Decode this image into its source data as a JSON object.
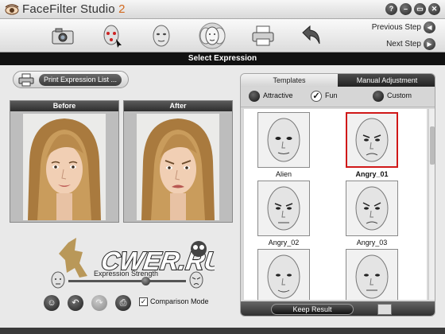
{
  "app": {
    "title_main": "FaceFilter Studio",
    "title_version": "2",
    "window_buttons": [
      "?",
      "–",
      "▭",
      "✕"
    ]
  },
  "toolbar": {
    "tools": [
      "camera-icon",
      "face-points-icon",
      "face-edit-icon",
      "expressions-icon",
      "printer-icon",
      "share-icon"
    ],
    "previous_step": "Previous Step",
    "next_step": "Next Step"
  },
  "section_title": "Select Expression",
  "left": {
    "print_button": "Print Expression List ...",
    "before_label": "Before",
    "after_label": "After",
    "expression_strength_label": "Expression Strength",
    "comparison_mode_label": "Comparison Mode",
    "comparison_mode_checked": true,
    "watermark_text": "CWER.RU"
  },
  "right": {
    "tabs": [
      "Templates",
      "Manual Adjustment"
    ],
    "active_tab": "Templates",
    "filters": [
      {
        "label": "Attractive",
        "checked": false
      },
      {
        "label": "Fun",
        "checked": true
      },
      {
        "label": "Custom",
        "checked": false
      }
    ],
    "templates": [
      {
        "label": "Alien",
        "selected": false
      },
      {
        "label": "Angry_01",
        "selected": true
      },
      {
        "label": "Angry_02",
        "selected": false
      },
      {
        "label": "Angry_03",
        "selected": false
      },
      {
        "label": "",
        "selected": false
      },
      {
        "label": "",
        "selected": false
      }
    ],
    "keep_result": "Keep Result"
  },
  "colors": {
    "selection": "#d01818",
    "version_accent": "#d2691e",
    "section_bar": "#111111"
  }
}
